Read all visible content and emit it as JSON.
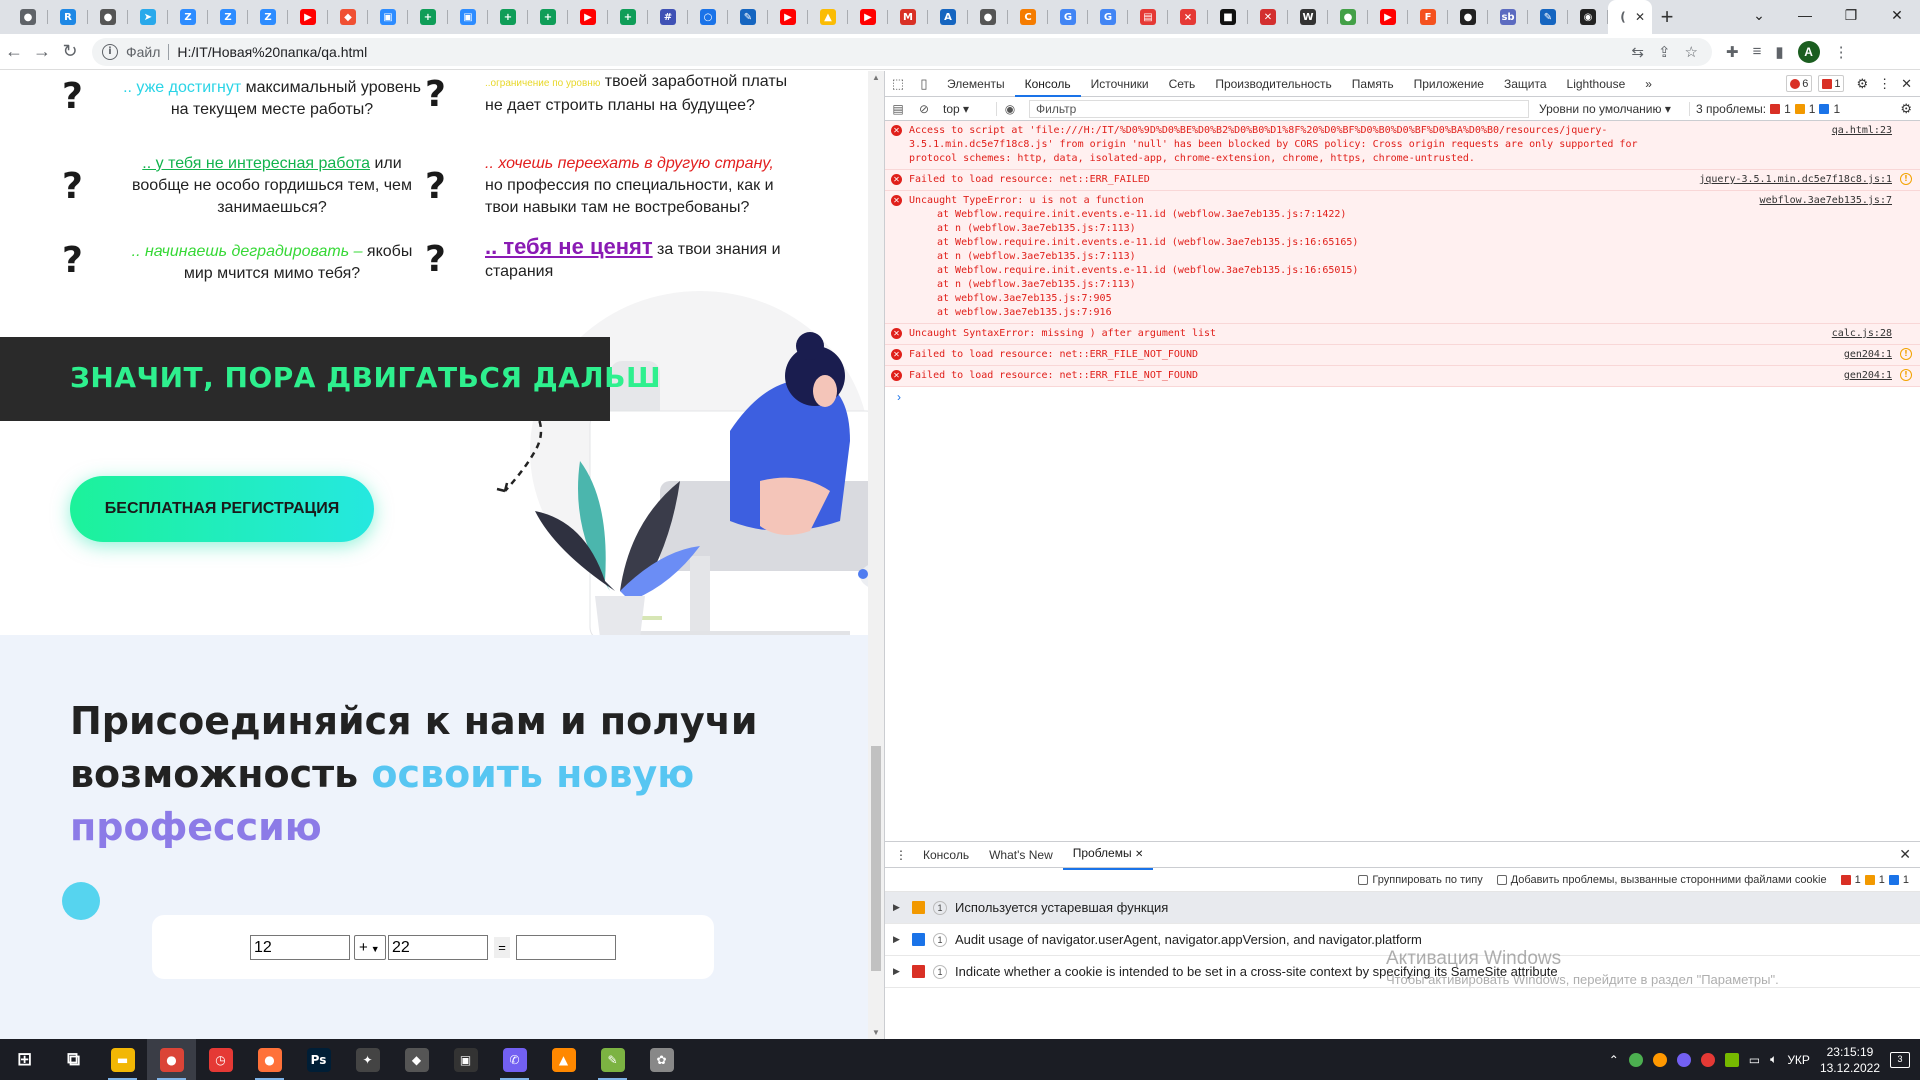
{
  "browser": {
    "tabs": [
      {
        "icon": "chrome-icon",
        "glyph": "●",
        "color": "#5f6368"
      },
      {
        "icon": "r-icon",
        "glyph": "R",
        "color": "#1e88e5"
      },
      {
        "icon": "globe-icon",
        "glyph": "●",
        "color": "#555"
      },
      {
        "icon": "telegram-icon",
        "glyph": "➤",
        "color": "#29a9eb"
      },
      {
        "icon": "zoom-icon",
        "glyph": "Z",
        "color": "#2d8cff"
      },
      {
        "icon": "zoom-icon",
        "glyph": "Z",
        "color": "#2d8cff"
      },
      {
        "icon": "zoom-icon",
        "glyph": "Z",
        "color": "#2d8cff"
      },
      {
        "icon": "youtube-icon",
        "glyph": "▶",
        "color": "#ff0000"
      },
      {
        "icon": "git-icon",
        "glyph": "◆",
        "color": "#f05033"
      },
      {
        "icon": "meet-icon",
        "glyph": "▣",
        "color": "#2d8cff"
      },
      {
        "icon": "sheets-icon",
        "glyph": "+",
        "color": "#0f9d58"
      },
      {
        "icon": "meet-icon",
        "glyph": "▣",
        "color": "#2d8cff"
      },
      {
        "icon": "sheets-icon",
        "glyph": "+",
        "color": "#0f9d58"
      },
      {
        "icon": "sheets-icon",
        "glyph": "+",
        "color": "#0f9d58"
      },
      {
        "icon": "youtube-icon",
        "glyph": "▶",
        "color": "#ff0000"
      },
      {
        "icon": "sheets-icon",
        "glyph": "+",
        "color": "#0f9d58"
      },
      {
        "icon": "grid-icon",
        "glyph": "#",
        "color": "#3f51b5"
      },
      {
        "icon": "pin-icon",
        "glyph": "○",
        "color": "#1a73e8"
      },
      {
        "icon": "pen-icon",
        "glyph": "✎",
        "color": "#1565c0"
      },
      {
        "icon": "youtube-icon",
        "glyph": "▶",
        "color": "#ff0000"
      },
      {
        "icon": "drive-icon",
        "glyph": "▲",
        "color": "#fbbc04"
      },
      {
        "icon": "youtube-icon",
        "glyph": "▶",
        "color": "#ff0000"
      },
      {
        "icon": "gmail-icon",
        "glyph": "M",
        "color": "#d93025"
      },
      {
        "icon": "a-icon",
        "glyph": "A",
        "color": "#1565c0"
      },
      {
        "icon": "globe-icon",
        "glyph": "●",
        "color": "#555"
      },
      {
        "icon": "c-icon",
        "glyph": "C",
        "color": "#f57c00"
      },
      {
        "icon": "google-icon",
        "glyph": "G",
        "color": "#4285f4"
      },
      {
        "icon": "google-icon",
        "glyph": "G",
        "color": "#4285f4"
      },
      {
        "icon": "basket-icon",
        "glyph": "▤",
        "color": "#e53935"
      },
      {
        "icon": "x-icon",
        "glyph": "×",
        "color": "#e53935"
      },
      {
        "icon": "film-icon",
        "glyph": "■",
        "color": "#111"
      },
      {
        "icon": "close-square-icon",
        "glyph": "✕",
        "color": "#d32f2f"
      },
      {
        "icon": "wikipedia-icon",
        "glyph": "W",
        "color": "#333"
      },
      {
        "icon": "green-circle-icon",
        "glyph": "●",
        "color": "#43a047"
      },
      {
        "icon": "youtube-icon",
        "glyph": "▶",
        "color": "#ff0000"
      },
      {
        "icon": "f-icon",
        "glyph": "F",
        "color": "#f4511e"
      },
      {
        "icon": "github-icon",
        "glyph": "●",
        "color": "#222"
      },
      {
        "icon": "sb-icon",
        "glyph": "sb",
        "color": "#5c6bc0"
      },
      {
        "icon": "pen-icon",
        "glyph": "✎",
        "color": "#1565c0"
      },
      {
        "icon": "circle-icon",
        "glyph": "◉",
        "color": "#222"
      }
    ],
    "active_tab": {
      "icon": "loading-icon",
      "glyph": "(",
      "close": "✕"
    },
    "new_tab": "+",
    "window_controls": [
      "⌄",
      "—",
      "❐",
      "✕"
    ],
    "address": {
      "info": "i",
      "file_label": "Файл",
      "url": "H:/IT/Новая%20папка/qa.html"
    },
    "avatar": "A"
  },
  "page": {
    "questions": [
      {
        "pre": "",
        "highlight": ".. уже достигнут",
        "post": " максимальный уровень на текущем месте работы?"
      },
      {
        "pre": "",
        "highlight": "..ограничение по уровню",
        "post": " твоей заработной платы не дает строить планы на будущее?"
      },
      {
        "pre": "",
        "highlight": ".. у тебя не интересная работа",
        "post": " или вообще не особо гордишься тем, чем занимаешься?"
      },
      {
        "pre": "",
        "highlight": ".. хочешь переехать в другую страну,",
        "post": " но профессия по специальности, как и твои навыки там не востребованы?"
      },
      {
        "pre": "",
        "highlight": ".. начинаешь деградировать –",
        "post": " якобы мир мчится мимо тебя?"
      },
      {
        "pre": "",
        "highlight": ".. тебя не ценят",
        "post": " за твои знания и старания"
      }
    ],
    "question_mark": "?",
    "banner": "ЗНАЧИТ, ПОРА ДВИГАТЬСЯ ДАЛЬШ",
    "register_button": "БЕСПЛАТНАЯ РЕГИСТРАЦИЯ",
    "join_1": "Присоединяйся к нам и получи",
    "join_2": "возможность ",
    "join_highlight_1": "освоить новую",
    "join_highlight_2": "профессию",
    "calc": {
      "a": "12",
      "op": "+",
      "b": "22",
      "eq": "=",
      "result": ""
    }
  },
  "devtools": {
    "tabs": [
      "Элементы",
      "Консоль",
      "Источники",
      "Сеть",
      "Производительность",
      "Память",
      "Приложение",
      "Защита",
      "Lighthouse"
    ],
    "active_tab": "Консоль",
    "more": "»",
    "error_count": "6",
    "issue_count": "1",
    "context": "top",
    "filter_placeholder": "Фильтр",
    "levels": "Уровни по умолчанию",
    "problems_label": "3 проблемы:",
    "problems": {
      "errors": "1",
      "warnings": "1",
      "info": "1"
    },
    "messages": [
      {
        "text": "Access to script at 'file:///H:/IT/%D0%9D%D0%BE%D0%B2%D0%B0%D1%8F%20%D0%BF%D0%B0%D0%BF%D0%BA%D0%B0/resources/jquery-3.5.1.min.dc5e7f18c8.js' from origin 'null' has been blocked by CORS policy: Cross origin requests are only supported for protocol schemes: http, data, isolated-app, chrome-extension, chrome, https, chrome-untrusted.",
        "src": "qa.html:23",
        "warn": false
      },
      {
        "text": "Failed to load resource: net::ERR_FAILED",
        "src": "jquery-3.5.1.min.dc5e7f18c8.js:1",
        "warn": true
      },
      {
        "text": "Uncaught TypeError: u is not a function",
        "src": "webflow.3ae7eb135.js:7",
        "warn": false,
        "stack": [
          "at Webflow.require.init.events.e-11.id (webflow.3ae7eb135.js:7:1422)",
          "at n (webflow.3ae7eb135.js:7:113)",
          "at Webflow.require.init.events.e-11.id (webflow.3ae7eb135.js:16:65165)",
          "at n (webflow.3ae7eb135.js:7:113)",
          "at Webflow.require.init.events.e-11.id (webflow.3ae7eb135.js:16:65015)",
          "at n (webflow.3ae7eb135.js:7:113)",
          "at webflow.3ae7eb135.js:7:905",
          "at webflow.3ae7eb135.js:7:916"
        ]
      },
      {
        "text": "Uncaught SyntaxError: missing ) after argument list",
        "src": "calc.js:28",
        "warn": false
      },
      {
        "text": "Failed to load resource: net::ERR_FILE_NOT_FOUND",
        "src": "gen204:1",
        "warn": true
      },
      {
        "text": "Failed to load resource: net::ERR_FILE_NOT_FOUND",
        "src": "gen204:1",
        "warn": true
      }
    ],
    "prompt": "›",
    "drawer": {
      "tabs": [
        "Консоль",
        "What's New",
        "Проблемы"
      ],
      "active": "Проблемы",
      "group_label": "Группировать по типу",
      "third_party_label": "Добавить проблемы, вызванные сторонними файлами cookie",
      "counts": {
        "errors": "1",
        "warnings": "1",
        "info": "1"
      },
      "issues": [
        {
          "kind": "warning",
          "count": "1",
          "text": "Используется устаревшая функция"
        },
        {
          "kind": "info",
          "count": "1",
          "text": "Audit usage of navigator.userAgent, navigator.appVersion, and navigator.platform"
        },
        {
          "kind": "error",
          "count": "1",
          "text": "Indicate whether a cookie is intended to be set in a cross-site context by specifying its SameSite attribute"
        }
      ]
    }
  },
  "watermark": {
    "line1": "Активация Windows",
    "line2": "Чтобы активировать Windows, перейдите в раздел \"Параметры\"."
  },
  "taskbar": {
    "apps": [
      {
        "name": "start-button",
        "glyph": "⊞",
        "color": "transparent"
      },
      {
        "name": "task-view-icon",
        "glyph": "⧉",
        "color": "transparent"
      },
      {
        "name": "file-explorer-icon",
        "glyph": "▬",
        "color": "#f2b705"
      },
      {
        "name": "chrome-taskbar-icon",
        "glyph": "●",
        "color": "#db4437"
      },
      {
        "name": "clock-app-icon",
        "glyph": "◷",
        "color": "#e53935"
      },
      {
        "name": "firefox-icon",
        "glyph": "●",
        "color": "#ff7139"
      },
      {
        "name": "photoshop-icon",
        "glyph": "Ps",
        "color": "#001e36"
      },
      {
        "name": "game-icon",
        "glyph": "✦",
        "color": "#444"
      },
      {
        "name": "shield-app-icon",
        "glyph": "◆",
        "color": "#555"
      },
      {
        "name": "game2-icon",
        "glyph": "▣",
        "color": "#333"
      },
      {
        "name": "viber-icon",
        "glyph": "✆",
        "color": "#7360f2"
      },
      {
        "name": "vlc-icon",
        "glyph": "▲",
        "color": "#ff8800"
      },
      {
        "name": "notepadpp-icon",
        "glyph": "✎",
        "color": "#7cb342"
      },
      {
        "name": "app-icon",
        "glyph": "✿",
        "color": "#888"
      }
    ],
    "lang": "УКР",
    "time": "23:15:19",
    "date": "13.12.2022",
    "notifications": "3"
  }
}
